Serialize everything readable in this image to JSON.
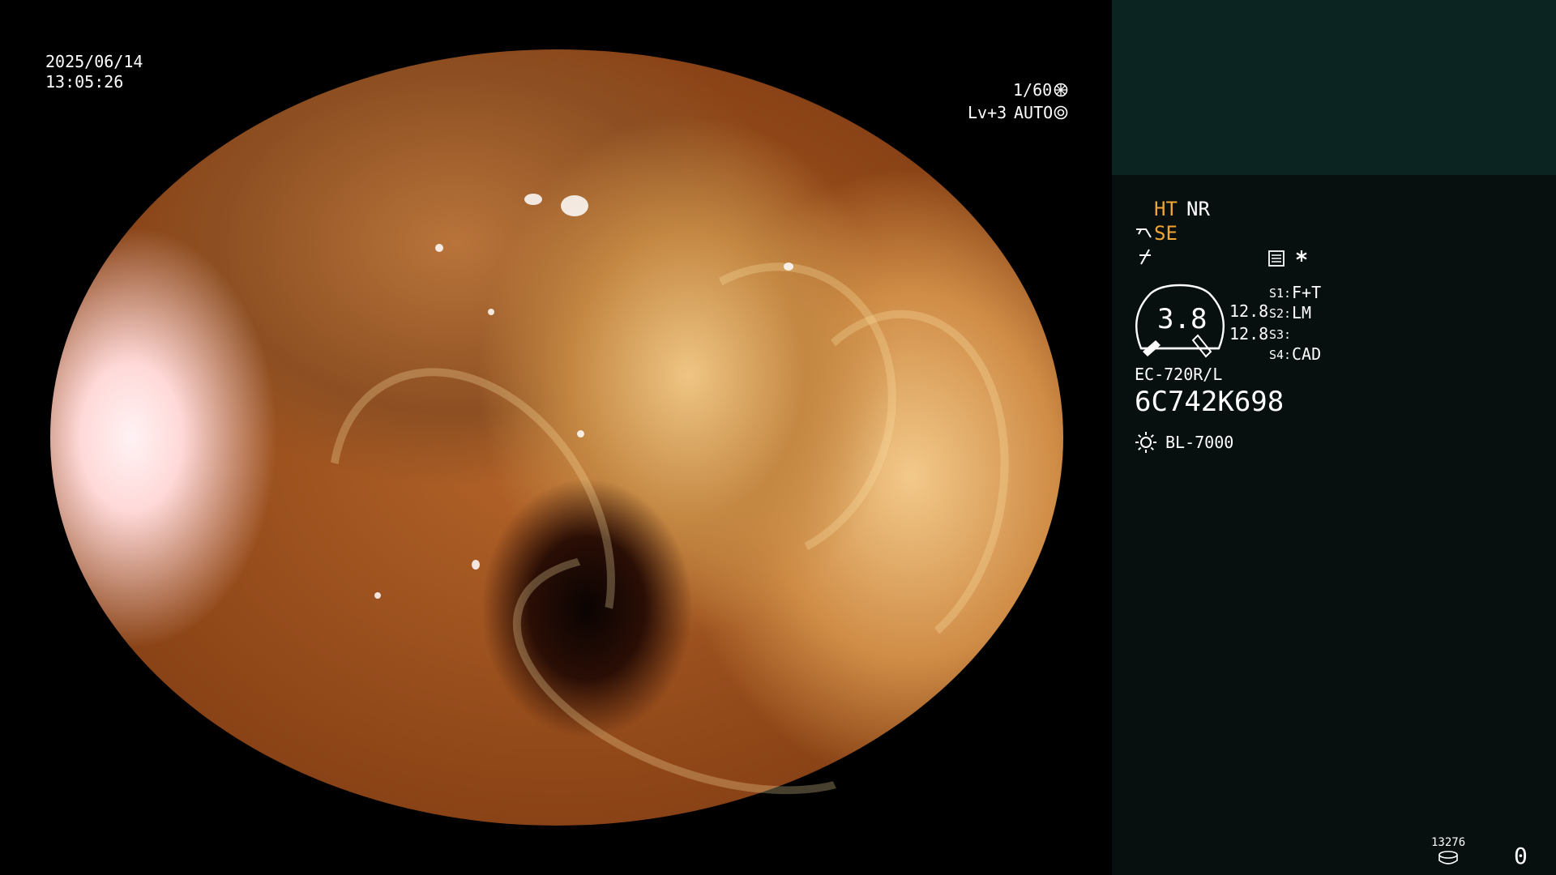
{
  "overlay": {
    "date": "2025/06/14",
    "time": "13:05:26",
    "shutter": "1/60",
    "level": "Lv+3",
    "iris_mode": "AUTO"
  },
  "panel": {
    "mode_ht": "HT",
    "mode_nr": "NR",
    "mode_se": "SE",
    "zoom_value": "3.8",
    "value_1": "12.8",
    "value_2": "12.8",
    "s1_label": "S1:",
    "s1_value": "F+T",
    "s2_label": "S2:",
    "s2_value": "LM",
    "s3_label": "S3:",
    "s3_value": "",
    "s4_label": "S4:",
    "s4_value": "CAD",
    "scope_model": "EC-720R/L",
    "scope_serial": "6C742K698",
    "light_source": "BL-7000",
    "storage_count": "13276",
    "counter": "0"
  },
  "colors": {
    "panel_bg": "#07100f",
    "panel_top_bg": "#0b2321",
    "accent": "#f3a534"
  },
  "icons": [
    "shutter-icon",
    "iris-icon",
    "scope-tip-icon",
    "freeze-icon",
    "menu-icon",
    "asterisk-icon",
    "zoom-gauge-icon",
    "light-source-icon",
    "storage-icon"
  ]
}
